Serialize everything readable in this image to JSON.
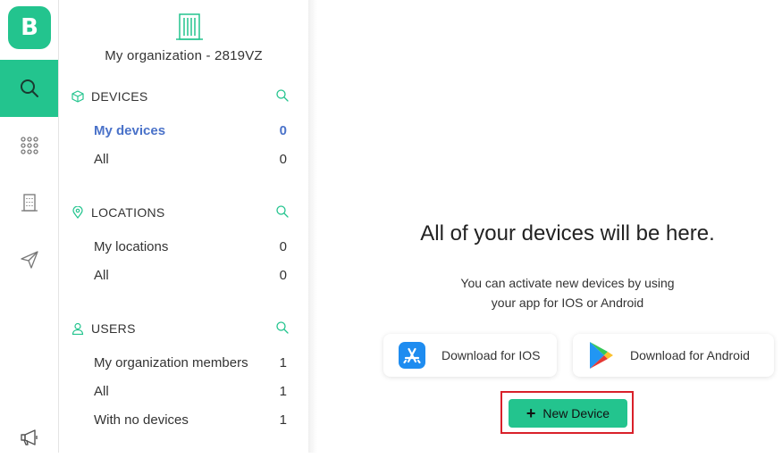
{
  "rail": {
    "logo_letter": "B",
    "items": [
      {
        "icon": "search-icon"
      },
      {
        "icon": "grid-icon"
      },
      {
        "icon": "building-icon"
      },
      {
        "icon": "send-icon"
      },
      {
        "icon": "megaphone-icon"
      }
    ]
  },
  "sidebar": {
    "org_title": "My organization - 2819VZ",
    "sections": [
      {
        "label": "DEVICES",
        "icon": "cube-icon",
        "rows": [
          {
            "name": "My devices",
            "count": "0"
          },
          {
            "name": "All",
            "count": "0"
          }
        ]
      },
      {
        "label": "LOCATIONS",
        "icon": "location-pin-icon",
        "rows": [
          {
            "name": "My locations",
            "count": "0"
          },
          {
            "name": "All",
            "count": "0"
          }
        ]
      },
      {
        "label": "USERS",
        "icon": "user-icon",
        "rows": [
          {
            "name": "My organization members",
            "count": "1"
          },
          {
            "name": "All",
            "count": "1"
          },
          {
            "name": "With no devices",
            "count": "1"
          }
        ]
      }
    ]
  },
  "main": {
    "title": "All of your devices will be here.",
    "subtitle_line1": "You can activate new devices by using",
    "subtitle_line2": "your app for IOS or Android",
    "ios_button": "Download for IOS",
    "android_button": "Download for Android",
    "new_device_button": "New Device",
    "new_device_plus": "+"
  },
  "colors": {
    "accent": "#23c48e",
    "active_link": "#4a72c9",
    "highlight": "#d9202a"
  }
}
